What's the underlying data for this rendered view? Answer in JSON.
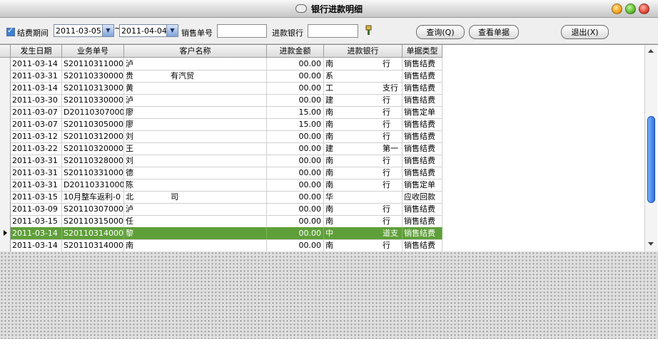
{
  "window": {
    "title": "银行进款明细"
  },
  "toolbar": {
    "period_label": "结费期间",
    "date_from": "2011-03-05",
    "date_sep": "~",
    "date_to": "2011-04-04",
    "sale_no_label": "销售单号",
    "sale_no_value": "",
    "bank_label": "进款银行",
    "bank_value": "",
    "query_button": "查询(Q)",
    "view_button": "查看单据",
    "exit_button": "退出(X)"
  },
  "table": {
    "columns": [
      "发生日期",
      "业务单号",
      "客户名称",
      "进款金额",
      "进款银行",
      "单据类型"
    ],
    "rows": [
      {
        "date": "2011-03-14",
        "no": "S201103110001",
        "customer": "泸",
        "amount": "00.00",
        "bank": "南",
        "bank_tail": "行",
        "type": "销售结费"
      },
      {
        "date": "2011-03-31",
        "no": "S201103300002",
        "customer": "贵",
        "customer_tail": "有汽贸",
        "amount": "00.00",
        "bank": "系",
        "bank_tail": "",
        "type": "销售结费"
      },
      {
        "date": "2011-03-14",
        "no": "S201103130001",
        "customer": "黄",
        "amount": "00.00",
        "bank": "工",
        "bank_tail": "支行",
        "type": "销售结费"
      },
      {
        "date": "2011-03-30",
        "no": "S201103300003",
        "customer": "泸",
        "amount": "00.00",
        "bank": "建",
        "bank_tail": "行",
        "type": "销售结费"
      },
      {
        "date": "2011-03-07",
        "no": "D201103070001",
        "customer": "廖",
        "amount": "15.00",
        "bank": "南",
        "bank_tail": "行",
        "type": "销售定单"
      },
      {
        "date": "2011-03-07",
        "no": "S201103050001",
        "customer": "廖",
        "amount": "15.00",
        "bank": "南",
        "bank_tail": "行",
        "type": "销售结费"
      },
      {
        "date": "2011-03-12",
        "no": "S201103120001",
        "customer": "刘",
        "amount": "00.00",
        "bank": "南",
        "bank_tail": "行",
        "type": "销售结费"
      },
      {
        "date": "2011-03-22",
        "no": "S201103200002",
        "customer": "王",
        "amount": "00.00",
        "bank": "建",
        "bank_tail": "第一",
        "type": "销售结费"
      },
      {
        "date": "2011-03-31",
        "no": "S201103280001",
        "customer": "刘",
        "amount": "00.00",
        "bank": "南",
        "bank_tail": "行",
        "type": "销售结费"
      },
      {
        "date": "2011-03-31",
        "no": "S201103310002",
        "customer": "德",
        "amount": "00.00",
        "bank": "南",
        "bank_tail": "行",
        "type": "销售结费"
      },
      {
        "date": "2011-03-31",
        "no": "D201103310001",
        "customer": "陈",
        "amount": "00.00",
        "bank": "南",
        "bank_tail": "行",
        "type": "销售定单"
      },
      {
        "date": "2011-03-15",
        "no": "10月整车返利-0",
        "customer": "北",
        "customer_tail": "司",
        "amount": "00.00",
        "bank": "华",
        "bank_tail": "",
        "type": "应收回款"
      },
      {
        "date": "2011-03-09",
        "no": "S201103070001",
        "customer": "泸",
        "amount": "00.00",
        "bank": "南",
        "bank_tail": "行",
        "type": "销售结费"
      },
      {
        "date": "2011-03-15",
        "no": "S201103150001",
        "customer": "任",
        "amount": "00.00",
        "bank": "南",
        "bank_tail": "行",
        "type": "销售结费"
      },
      {
        "date": "2011-03-14",
        "no": "S201103140001",
        "customer": "黎",
        "amount": "00.00",
        "bank": "中",
        "bank_tail": "道支",
        "type": "销售结费",
        "selected": true
      },
      {
        "date": "2011-03-14",
        "no": "S201103140003",
        "customer": "南",
        "amount": "00.00",
        "bank": "南",
        "bank_tail": "行",
        "type": "销售结费"
      }
    ]
  },
  "colors": {
    "selection": "#5f9f3a",
    "scroll_thumb": "#2f72e0"
  }
}
